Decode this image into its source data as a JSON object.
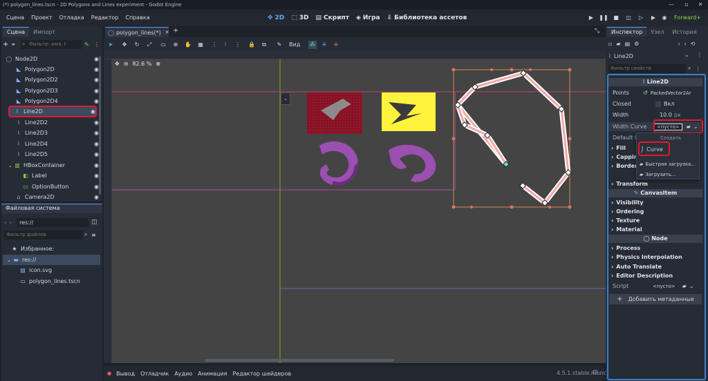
{
  "window": {
    "title": "(*) polygon_lines.tscn - 2D Polygons and Lines experiment - Godot Engine",
    "minimize": "—",
    "maximize": "▫",
    "close": "✕"
  },
  "menu": [
    "Сцена",
    "Проект",
    "Отладка",
    "Редактор",
    "Справка"
  ],
  "workspaces": {
    "w2d": "2D",
    "w3d": "3D",
    "script": "Скрипт",
    "game": "Игра",
    "assetlib": "Библиотека ассетов"
  },
  "renderer": "Forward+",
  "scene_dock": {
    "tabs": [
      "Сцена",
      "Импорт"
    ],
    "filter_placeholder": "Фильтр: имя, t",
    "nodes": [
      "Node2D",
      "Polygon2D",
      "Polygon2D2",
      "Polygon2D3",
      "Polygon2D4",
      "Line2D",
      "Line2D2",
      "Line2D3",
      "Line2D4",
      "Line2D5",
      "HBoxContainer",
      "Label",
      "OptionButton",
      "Camera2D"
    ]
  },
  "fs_dock": {
    "title": "Файловая система",
    "path": "res://",
    "filter_placeholder": "Фильтр файлов",
    "favorites": "Избранное:",
    "items": [
      "res://",
      "icon.svg",
      "polygon_lines.tscn"
    ]
  },
  "editor": {
    "tab": "polygon_lines(*)",
    "zoom": "82.6 %",
    "view_menu": "Вид"
  },
  "inspector": {
    "tabs": [
      "Инспектор",
      "Узел",
      "История"
    ],
    "node": "Line2D",
    "filter_placeholder": "Фильтр свойств",
    "class_title": "Line2D",
    "props": {
      "points_label": "Points",
      "points_value": "PackedVector2Ar",
      "closed_label": "Closed",
      "closed_value": "Вкл",
      "width_label": "Width",
      "width_value": "10.0",
      "width_unit": "px",
      "width_curve_label": "Width Curve",
      "width_curve_value": "<пусто>",
      "default_color_label": "Default Col"
    },
    "popup": {
      "create": "Создать",
      "curve": "Curve",
      "quick_load": "Быстрая загрузка...",
      "load": "Загрузить..."
    },
    "groups": [
      "Fill",
      "Capping",
      "Border",
      "Transform"
    ],
    "canvasitem": "CanvasItem",
    "ci_groups": [
      "Visibility",
      "Ordering",
      "Texture",
      "Material"
    ],
    "node_cat": "Node",
    "node_groups": [
      "Process",
      "Physics Interpolation",
      "Auto Translate",
      "Editor Description"
    ],
    "script_label": "Script",
    "script_value": "<пусто>",
    "add_meta": "Добавить метаданные"
  },
  "bottom": {
    "tabs": [
      "Вывод",
      "Отладчик",
      "Аудио",
      "Анимация",
      "Редактор шейдеров"
    ],
    "version": "4.5.1.stable.mono"
  },
  "colors": {
    "accent": "#5c9aff",
    "red_highlight": "#e8162e",
    "viewport": "#444444",
    "poly_red": "#8a1426",
    "poly_yellow": "#fff23c",
    "purple": "#9b4fb0"
  }
}
